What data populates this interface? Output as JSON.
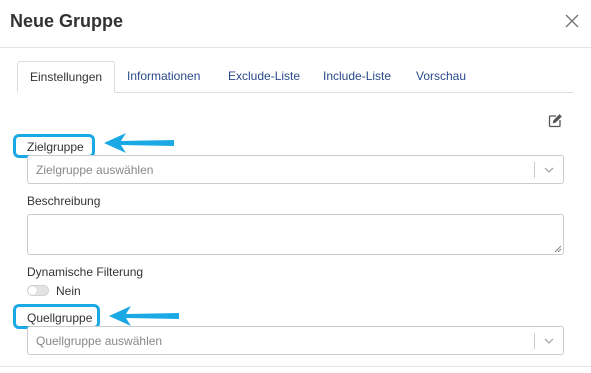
{
  "dialog": {
    "title": "Neue Gruppe",
    "close_icon": "close-icon"
  },
  "tabs": [
    {
      "label": "Einstellungen",
      "active": true
    },
    {
      "label": "Informationen",
      "active": false
    },
    {
      "label": "Exclude-Liste",
      "active": false
    },
    {
      "label": "Include-Liste",
      "active": false
    },
    {
      "label": "Vorschau",
      "active": false
    }
  ],
  "form": {
    "edit_icon": "edit-icon",
    "zielgruppe": {
      "label": "Zielgruppe",
      "placeholder": "Zielgruppe auswählen"
    },
    "beschreibung": {
      "label": "Beschreibung",
      "value": ""
    },
    "filter": {
      "label": "Dynamische Filterung",
      "value_label": "Nein",
      "enabled": false
    },
    "quellgruppe": {
      "label": "Quellgruppe",
      "placeholder": "Quellgruppe auswählen"
    }
  },
  "colors": {
    "highlight": "#1ba9e6",
    "tab_link": "#2a4a8a"
  }
}
